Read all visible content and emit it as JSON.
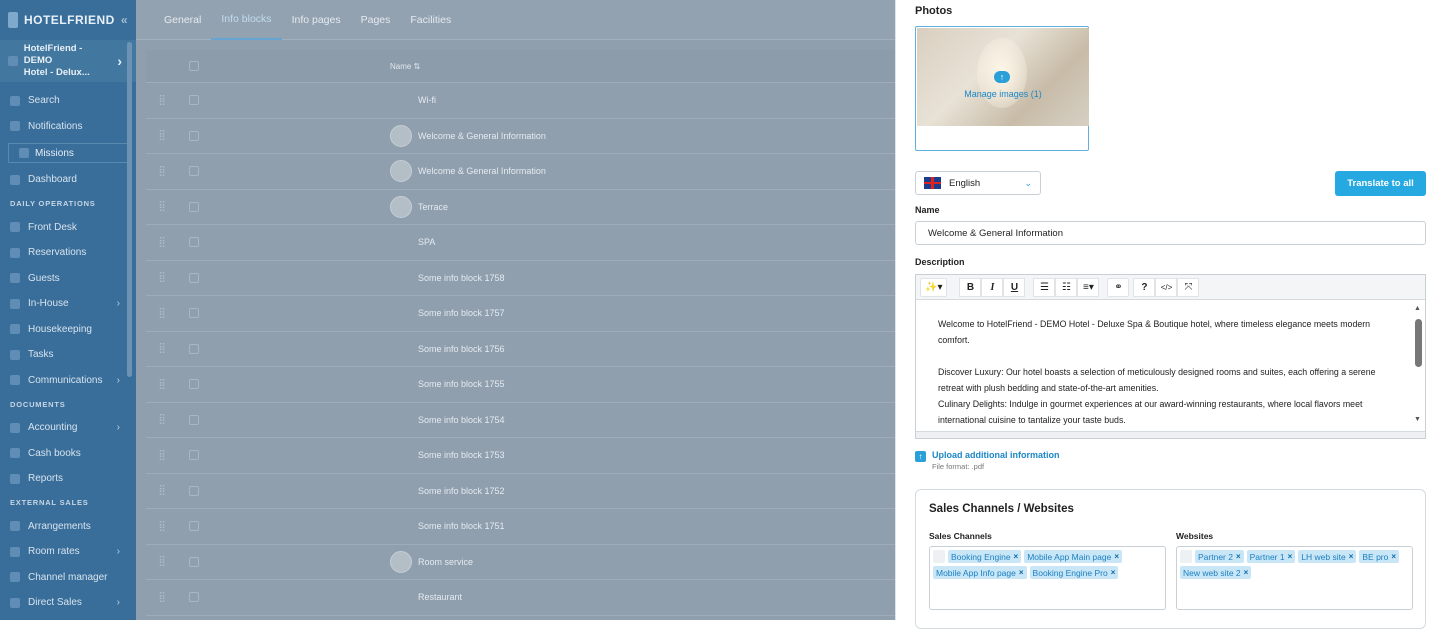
{
  "sidebar": {
    "brand": "HOTELFRIEND",
    "hotel": [
      "HotelFriend - DEMO",
      "Hotel - Delux..."
    ],
    "top_items": [
      {
        "label": "Search",
        "icon": "search-icon"
      },
      {
        "label": "Notifications",
        "icon": "bell-icon"
      }
    ],
    "missions": "Missions",
    "dashboard": "Dashboard",
    "sections": [
      {
        "title": "DAILY OPERATIONS",
        "items": [
          {
            "label": "Front Desk",
            "arrow": false
          },
          {
            "label": "Reservations",
            "arrow": false
          },
          {
            "label": "Guests",
            "arrow": false
          },
          {
            "label": "In-House",
            "arrow": true
          },
          {
            "label": "Housekeeping",
            "arrow": false
          },
          {
            "label": "Tasks",
            "arrow": false
          },
          {
            "label": "Communications",
            "arrow": true
          }
        ]
      },
      {
        "title": "DOCUMENTS",
        "items": [
          {
            "label": "Accounting",
            "arrow": true
          },
          {
            "label": "Cash books",
            "arrow": false
          },
          {
            "label": "Reports",
            "arrow": false
          }
        ]
      },
      {
        "title": "EXTERNAL SALES",
        "items": [
          {
            "label": "Arrangements",
            "arrow": false
          },
          {
            "label": "Room rates",
            "arrow": true
          },
          {
            "label": "Channel manager",
            "arrow": false
          },
          {
            "label": "Direct Sales",
            "arrow": true
          }
        ]
      }
    ]
  },
  "tabs": [
    "General",
    "Info blocks",
    "Info pages",
    "Pages",
    "Facilities"
  ],
  "active_tab": 1,
  "table": {
    "header": "Name ⇅",
    "rows": [
      {
        "name": "Wi-fi",
        "thumb": false
      },
      {
        "name": "Welcome & General Information",
        "thumb": true
      },
      {
        "name": "Welcome & General Information",
        "thumb": true
      },
      {
        "name": "Terrace",
        "thumb": true
      },
      {
        "name": "SPA",
        "thumb": false
      },
      {
        "name": "Some info block 1758",
        "thumb": false
      },
      {
        "name": "Some info block 1757",
        "thumb": false
      },
      {
        "name": "Some info block 1756",
        "thumb": false
      },
      {
        "name": "Some info block 1755",
        "thumb": false
      },
      {
        "name": "Some info block 1754",
        "thumb": false
      },
      {
        "name": "Some info block 1753",
        "thumb": false
      },
      {
        "name": "Some info block 1752",
        "thumb": false
      },
      {
        "name": "Some info block 1751",
        "thumb": false
      },
      {
        "name": "Room service",
        "thumb": true
      },
      {
        "name": "Restaurant",
        "thumb": false
      }
    ]
  },
  "panel": {
    "photos_title": "Photos",
    "manage_images": "Manage images (1)",
    "language": "English",
    "translate_button": "Translate to all",
    "name_label": "Name",
    "name_value": "Welcome & General Information",
    "description_label": "Description",
    "description": [
      "Welcome to HotelFriend - DEMO Hotel - Deluxe Spa & Boutique hotel, where timeless elegance meets modern comfort.",
      "",
      "Discover Luxury: Our hotel boasts a selection of meticulously designed rooms and suites, each offering a serene retreat with plush bedding and state-of-the-art amenities.",
      "Culinary Delights: Indulge in gourmet experiences at our award-winning restaurants, where local flavors meet international cuisine to tantalize your taste buds."
    ],
    "upload_label": "Upload additional information",
    "file_format": "File format: .pdf",
    "sales_title": "Sales Channels / Websites",
    "sales_channels_label": "Sales Channels",
    "websites_label": "Websites",
    "sales_channels": [
      "Booking Engine",
      "Mobile App Main page",
      "Mobile App Info page",
      "Booking Engine Pro"
    ],
    "websites": [
      "Partner 2",
      "Partner 1",
      "LH web site",
      "BE pro",
      "New web site 2"
    ]
  },
  "colors": {
    "accent": "#26a8e0",
    "sidebar": "#3a6e9a",
    "tag_bg": "#c9e6f7"
  }
}
